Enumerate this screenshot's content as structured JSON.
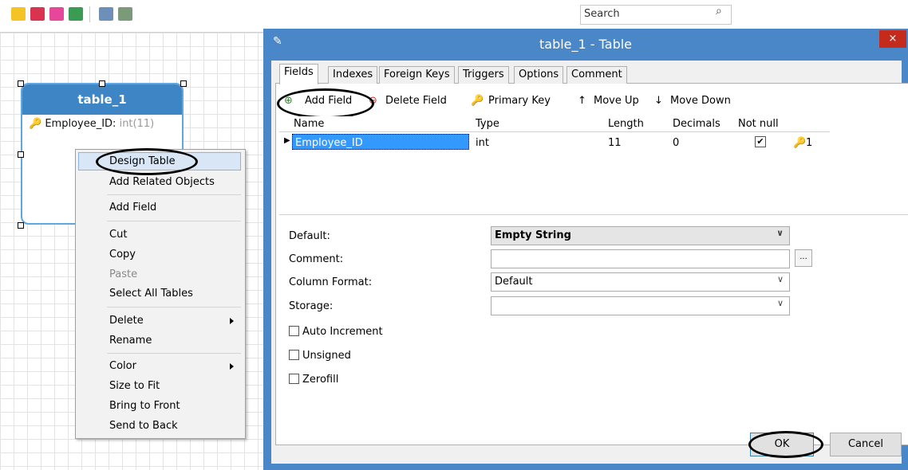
{
  "toolbar": {
    "icons": [
      "note-icon",
      "image-icon",
      "layer-icon",
      "layout-icon",
      "auto-arrange-icon",
      "diagram-icon"
    ],
    "search_placeholder": "Search"
  },
  "diagram": {
    "table_title": "table_1",
    "field_name": "Employee_ID:",
    "field_type": "int(11)"
  },
  "context_menu": {
    "items": [
      {
        "label": "Design Table"
      },
      {
        "label": "Add Related Objects"
      },
      {
        "label": "Add Field"
      },
      {
        "label": "Cut"
      },
      {
        "label": "Copy"
      },
      {
        "label": "Paste",
        "disabled": true
      },
      {
        "label": "Select All Tables"
      },
      {
        "label": "Delete",
        "submenu": true
      },
      {
        "label": "Rename"
      },
      {
        "label": "Color",
        "submenu": true
      },
      {
        "label": "Size to Fit"
      },
      {
        "label": "Bring to Front"
      },
      {
        "label": "Send to Back"
      }
    ]
  },
  "dialog": {
    "title": "table_1 - Table",
    "close": "×",
    "tabs": [
      "Fields",
      "Indexes",
      "Foreign Keys",
      "Triggers",
      "Options",
      "Comment"
    ],
    "field_toolbar": {
      "add_field": "Add Field",
      "delete_field": "Delete Field",
      "primary_key": "Primary Key",
      "move_up": "Move Up",
      "move_down": "Move Down"
    },
    "columns": [
      "Name",
      "Type",
      "Length",
      "Decimals",
      "Not null"
    ],
    "rows": [
      {
        "name": "Employee_ID",
        "type": "int",
        "length": "11",
        "decimals": "0",
        "not_null": "✔",
        "key": "1"
      }
    ],
    "props": {
      "default_label": "Default:",
      "default_value": "Empty String",
      "comment_label": "Comment:",
      "comment_value": "",
      "comment_btn": "...",
      "column_format_label": "Column Format:",
      "column_format_value": "Default",
      "storage_label": "Storage:",
      "storage_value": ""
    },
    "checkboxes": [
      "Auto Increment",
      "Unsigned",
      "Zerofill"
    ],
    "ok": "OK",
    "cancel": "Cancel"
  }
}
